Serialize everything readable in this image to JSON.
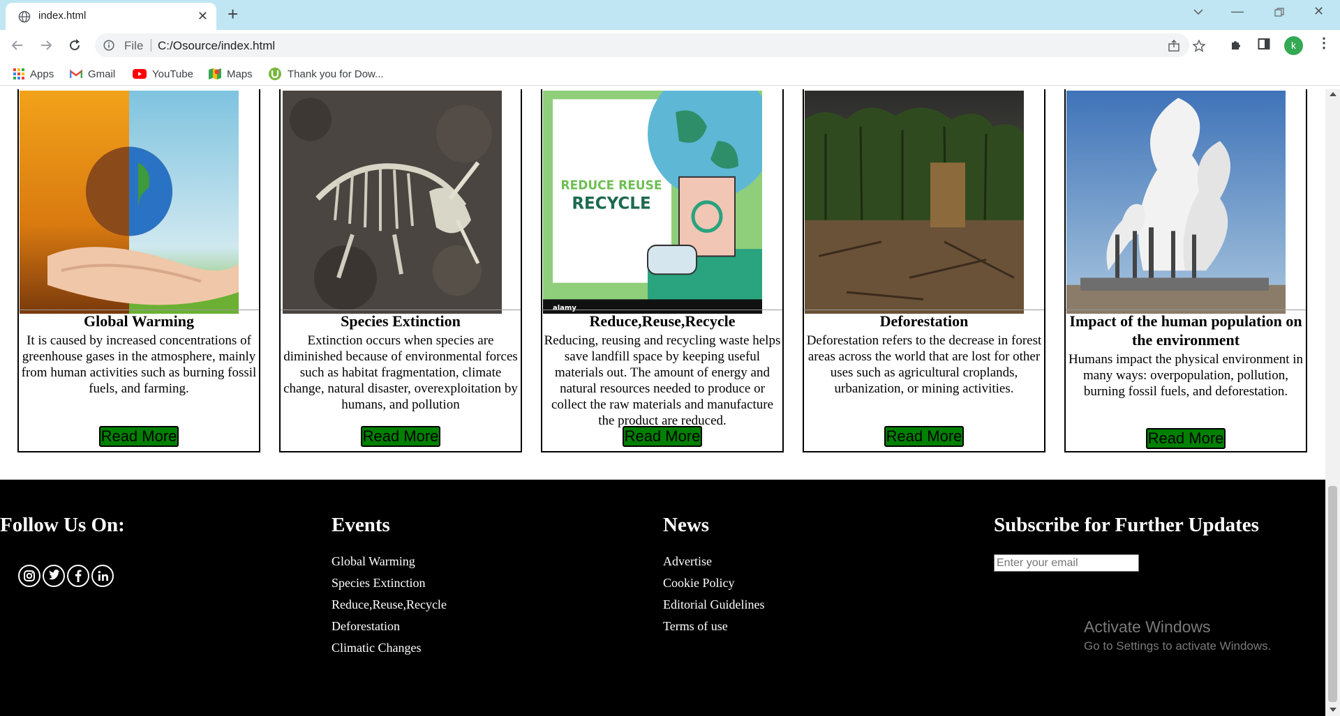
{
  "browser": {
    "tab_title": "index.html",
    "url_scheme": "File",
    "url": "C:/Osource/index.html",
    "profile_initial": "k",
    "bookmarks": [
      {
        "label": "Apps",
        "icon": "apps-grid-icon"
      },
      {
        "label": "Gmail",
        "icon": "gmail-icon"
      },
      {
        "label": "YouTube",
        "icon": "youtube-icon"
      },
      {
        "label": "Maps",
        "icon": "maps-icon"
      },
      {
        "label": "Thank you for Dow...",
        "icon": "utorrent-icon"
      }
    ]
  },
  "cards": [
    {
      "title": "Global Warming",
      "text": "It is caused by increased concentrations of greenhouse gases in the atmosphere, mainly from human activities such as burning fossil fuels, and farming.",
      "button": "Read More",
      "image": "earth-in-hands-image"
    },
    {
      "title": "Species Extinction",
      "text": "Extinction occurs when species are diminished because of environmental forces such as habitat fragmentation, climate change, natural disaster, overexploitation by humans, and pollution",
      "button": "Read More",
      "image": "dinosaur-fossil-image"
    },
    {
      "title": "Reduce,Reuse,Recycle",
      "text": "Reducing, reusing and recycling waste helps save landfill space by keeping useful materials out. The amount of energy and natural resources needed to produce or collect the raw materials and manufacture the product are reduced.",
      "button": "Read More",
      "image": "recycle-poster-image",
      "image_text_top": "REDUCE REUSE",
      "image_text_bottom": "RECYCLE",
      "image_brand": "alamy"
    },
    {
      "title": "Deforestation",
      "text": "Deforestation refers to the decrease in forest areas across the world that are lost for other uses such as agricultural croplands, urbanization, or mining activities.",
      "button": "Read More",
      "image": "cleared-forest-image"
    },
    {
      "title": "Impact of the human population on the environment",
      "text": "Humans impact the physical environment in many ways: overpopulation, pollution, burning fossil fuels, and deforestation.",
      "button": "Read More",
      "image": "factory-smoke-image"
    }
  ],
  "footer": {
    "follow": {
      "heading": "Follow Us On:",
      "icons": [
        "instagram-icon",
        "twitter-icon",
        "facebook-icon",
        "linkedin-icon"
      ]
    },
    "events": {
      "heading": "Events",
      "links": [
        "Global Warming",
        "Species Extinction",
        "Reduce,Reuse,Recycle",
        "Deforestation",
        "Climatic Changes"
      ]
    },
    "news": {
      "heading": "News",
      "links": [
        "Advertise",
        "Cookie Policy",
        "Editorial Guidelines",
        "Terms of use"
      ]
    },
    "subscribe": {
      "heading": "Subscribe for Further Updates",
      "placeholder": "Enter your email"
    }
  },
  "watermark": {
    "title": "Activate Windows",
    "subtitle": "Go to Settings to activate Windows."
  },
  "colors": {
    "tabbar": "#bfe6f2",
    "button_green": "#008000",
    "footer_bg": "#000000"
  }
}
